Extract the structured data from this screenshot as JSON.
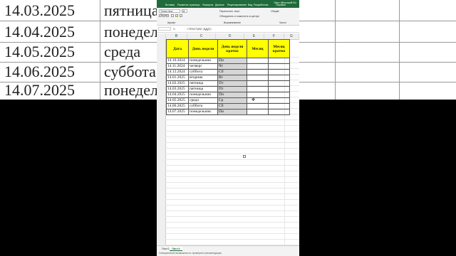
{
  "zoom_background": {
    "rows": [
      {
        "date": "14.03.2025",
        "day": "пятница"
      },
      {
        "date": "14.04.2025",
        "day": "понедель"
      },
      {
        "date": "14.05.2025",
        "day": "среда"
      },
      {
        "date": "14.06.2025",
        "day": "суббота"
      },
      {
        "date": "14.07.2025",
        "day": "понедель"
      }
    ]
  },
  "window": {
    "title": "Лист Microsoft Ex"
  },
  "ribbon_tabs": [
    "Вставка",
    "Разметка страницы",
    "Формулы",
    "Данные",
    "Рецензирование",
    "Вид",
    "Разработчик",
    "Справка"
  ],
  "ribbon": {
    "font_name": "Times New Roman",
    "font_size": "11",
    "wrap_text": "Переносить текст",
    "merge_center": "Объединить и поместить в центре",
    "group_font": "Шрифт",
    "group_alignment": "Выравнивание",
    "group_number": "Число",
    "number_format": "Общий"
  },
  "formula_bar": {
    "fx": "fx",
    "formula": "=ТЕКСТ(B2;\"ДДД\")"
  },
  "columns": [
    "B",
    "C",
    "D",
    "E",
    "F",
    "G"
  ],
  "table": {
    "headers": [
      "Дата",
      "День недели",
      "День недели кратко",
      "Месяц",
      "Месяц кратко"
    ],
    "rows": [
      {
        "date": "14.10.2024",
        "day": "понедельник",
        "short": "Пн"
      },
      {
        "date": "14.11.2024",
        "day": "четверг",
        "short": "Чт"
      },
      {
        "date": "14.12.2024",
        "day": "суббота",
        "short": "Сб"
      },
      {
        "date": "14.01.2025",
        "day": "вторник",
        "short": "Вт"
      },
      {
        "date": "14.02.2025",
        "day": "пятница",
        "short": "Пт"
      },
      {
        "date": "14.03.2025",
        "day": "пятница",
        "short": "Пт"
      },
      {
        "date": "14.04.2025",
        "day": "понедельник",
        "short": "Пн"
      },
      {
        "date": "14.05.2025",
        "day": "среда",
        "short": "Ср"
      },
      {
        "date": "14.06.2025",
        "day": "суббота",
        "short": "Сб"
      },
      {
        "date": "14.07.2025",
        "day": "понедельник",
        "short": "Пн"
      }
    ]
  },
  "sheet_tabs": [
    "Лист1",
    "Лист2"
  ],
  "active_sheet": "Лист2",
  "status": "Специальные возможности: проверьте рекомендации",
  "colors": {
    "excel_green": "#1f6b3a",
    "header_fill": "#ffff00",
    "selection": "#d6d6d6"
  }
}
